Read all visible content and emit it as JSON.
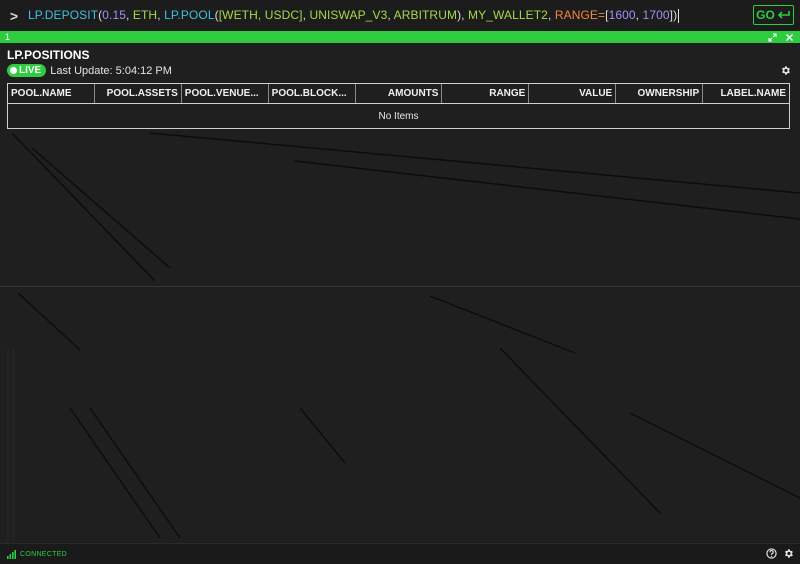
{
  "command_bar": {
    "prompt_glyph": ">",
    "tokens": [
      {
        "text": "LP.DEPOSIT",
        "kind": "fn"
      },
      {
        "text": "(",
        "kind": "punc"
      },
      {
        "text": "0.15",
        "kind": "num"
      },
      {
        "text": ", ",
        "kind": "punc"
      },
      {
        "text": "ETH",
        "kind": "arg"
      },
      {
        "text": ", ",
        "kind": "punc"
      },
      {
        "text": "LP.POOL",
        "kind": "fn"
      },
      {
        "text": "(",
        "kind": "punc"
      },
      {
        "text": "[WETH, USDC]",
        "kind": "arg"
      },
      {
        "text": ", ",
        "kind": "punc"
      },
      {
        "text": "UNISWAP_V3",
        "kind": "arg"
      },
      {
        "text": ", ",
        "kind": "punc"
      },
      {
        "text": "ARBITRUM",
        "kind": "arg"
      },
      {
        "text": "), ",
        "kind": "punc"
      },
      {
        "text": "MY_WALLET2",
        "kind": "arg"
      },
      {
        "text": ", ",
        "kind": "punc"
      },
      {
        "text": "RANGE=",
        "kind": "kw"
      },
      {
        "text": "[",
        "kind": "punc"
      },
      {
        "text": "1600",
        "kind": "num"
      },
      {
        "text": ", ",
        "kind": "punc"
      },
      {
        "text": "1700",
        "kind": "num"
      },
      {
        "text": "])",
        "kind": "punc"
      }
    ],
    "go_label": "GO",
    "go_icon": "enter-return-icon"
  },
  "panel_bar": {
    "id": "1",
    "expand_icon": "expand-arrows-icon",
    "close_icon": "close-icon"
  },
  "panel": {
    "title": "LP.POSITIONS",
    "live_label": "LIVE",
    "last_update": "Last Update: 5:04:12 PM",
    "settings_icon": "gear-icon",
    "table": {
      "columns": [
        {
          "label": "POOL.NAME",
          "align": "left"
        },
        {
          "label": "POOL.ASSETS",
          "align": "right"
        },
        {
          "label": "POOL.VENUE...",
          "align": "left"
        },
        {
          "label": "POOL.BLOCK...",
          "align": "left"
        },
        {
          "label": "AMOUNTS",
          "align": "right"
        },
        {
          "label": "RANGE",
          "align": "right"
        },
        {
          "label": "VALUE",
          "align": "right"
        },
        {
          "label": "OWNERSHIP",
          "align": "right"
        },
        {
          "label": "LABEL.NAME",
          "align": "right"
        }
      ],
      "rows": [],
      "empty_text": "No Items"
    }
  },
  "footer": {
    "status": "CONNECTED",
    "signal_icon": "signal-bars-icon",
    "help_icon": "help-circle-icon",
    "settings_icon": "gear-icon"
  },
  "colors": {
    "accent_green": "#2ecc40",
    "fn_blue": "#3ec0e0",
    "num_purple": "#a78bf5",
    "arg_green": "#a6d84a",
    "kw_orange": "#f2863a",
    "background": "#1f1f1f"
  }
}
